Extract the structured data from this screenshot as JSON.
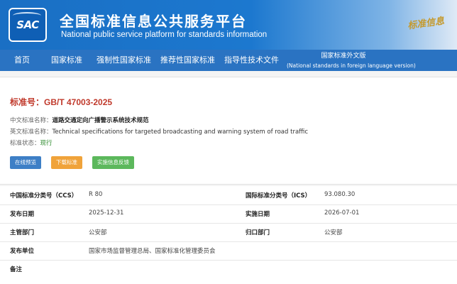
{
  "header": {
    "logo_text": "SAC",
    "title_cn": "全国标准信息公共服务平台",
    "title_en": "National public service platform  for standards information",
    "calligraphy": "标准信息"
  },
  "nav": {
    "items": [
      "首页",
      "国家标准",
      "强制性国家标准",
      "推荐性国家标准",
      "指导性技术文件"
    ],
    "foreign": {
      "line1": "国家标准外文版",
      "line2": "(National standards in foreign language version)"
    }
  },
  "standard": {
    "number": "标准号：GB/T 47003-2025",
    "cn_name_label": "中文标准名称：",
    "cn_name": "道路交通定向广播警示系统技术规范",
    "en_name_label": "英文标准名称：",
    "en_name": "Technical specifications for targeted broadcasting and warning system of road traffic",
    "status_label": "标准状态：",
    "status": "现行"
  },
  "buttons": {
    "preview": "在线预览",
    "download": "下载标准",
    "feedback": "实施信息反馈"
  },
  "details": {
    "ccs_label": "中国标准分类号（CCS）",
    "ccs": "R 80",
    "ics_label": "国际标准分类号（ICS）",
    "ics": "93.080.30",
    "publish_label": "发布日期",
    "publish": "2025-12-31",
    "impl_label": "实施日期",
    "impl": "2026-07-01",
    "dept_label": "主管部门",
    "dept": "公安部",
    "central_label": "归口部门",
    "central": "公安部",
    "issuer_label": "发布单位",
    "issuer": "国家市场监督管理总局、国家标准化管理委员会",
    "note_label": "备注",
    "note": ""
  },
  "colors": {
    "nav": "#2a73c2",
    "std_number": "#c0392b",
    "btn_preview": "#3d7fc6",
    "btn_download": "#f0a33a",
    "btn_feedback": "#5cb85c"
  }
}
